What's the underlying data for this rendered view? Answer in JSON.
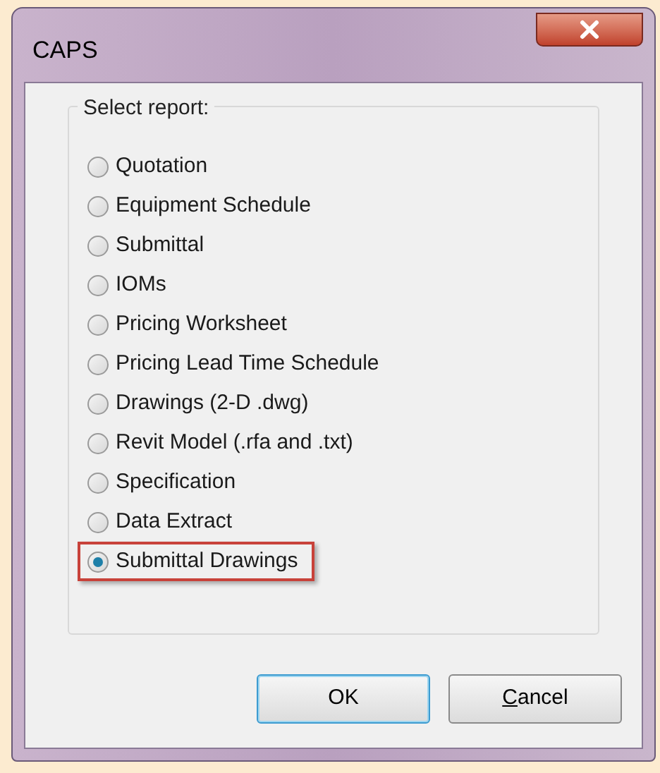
{
  "window": {
    "title": "CAPS"
  },
  "group": {
    "label": "Select report:"
  },
  "options": [
    {
      "label": "Quotation",
      "selected": false,
      "highlighted": false
    },
    {
      "label": "Equipment Schedule",
      "selected": false,
      "highlighted": false
    },
    {
      "label": "Submittal",
      "selected": false,
      "highlighted": false
    },
    {
      "label": "IOMs",
      "selected": false,
      "highlighted": false
    },
    {
      "label": "Pricing Worksheet",
      "selected": false,
      "highlighted": false
    },
    {
      "label": "Pricing Lead Time Schedule",
      "selected": false,
      "highlighted": false
    },
    {
      "label": "Drawings (2-D .dwg)",
      "selected": false,
      "highlighted": false
    },
    {
      "label": "Revit Model (.rfa and .txt)",
      "selected": false,
      "highlighted": false
    },
    {
      "label": "Specification",
      "selected": false,
      "highlighted": false
    },
    {
      "label": "Data Extract",
      "selected": false,
      "highlighted": false
    },
    {
      "label": "Submittal Drawings",
      "selected": true,
      "highlighted": true
    }
  ],
  "buttons": [
    {
      "label": "OK",
      "kind": "default"
    },
    {
      "label": "Cancel",
      "kind": "mnemonic"
    }
  ]
}
